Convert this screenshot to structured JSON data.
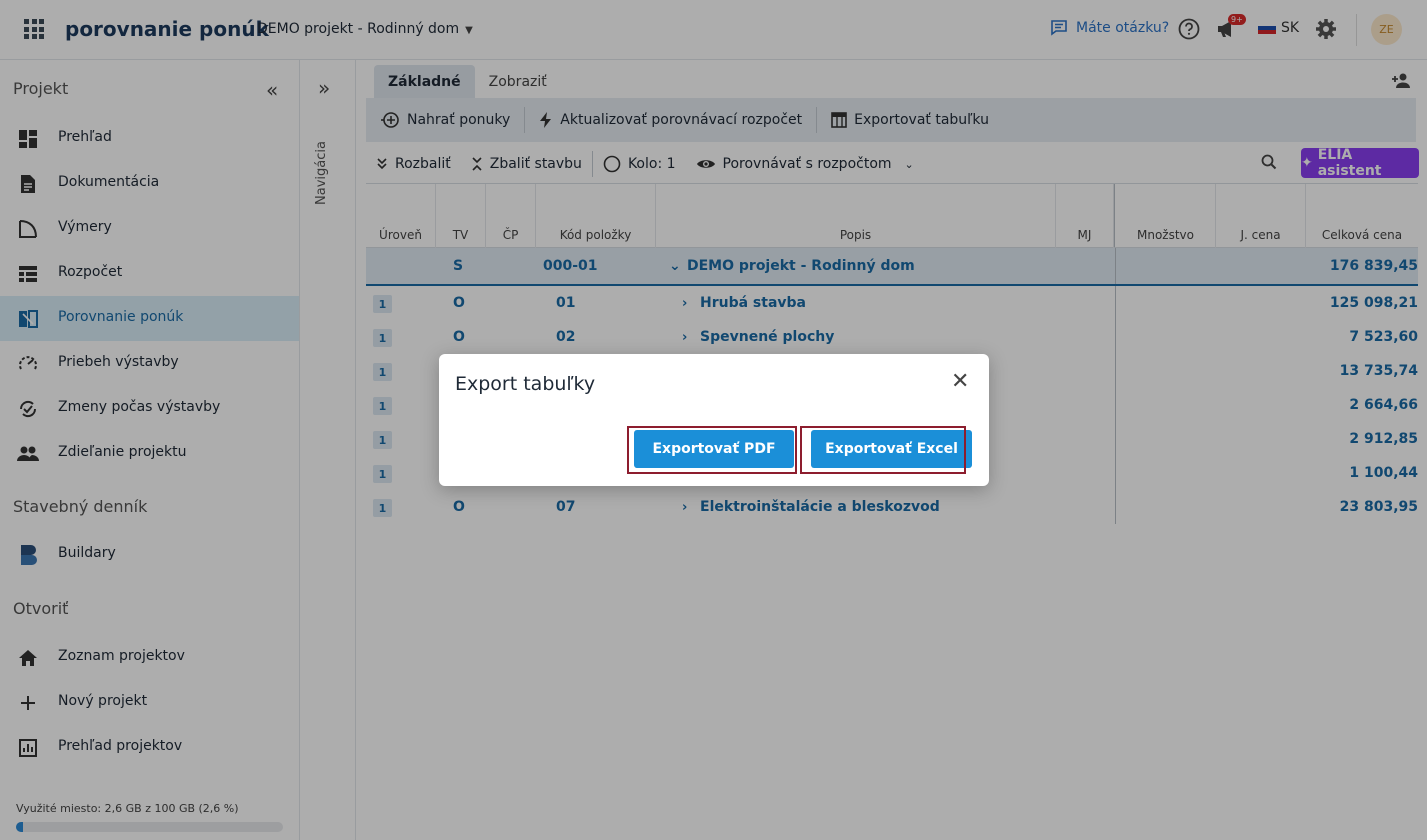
{
  "app": {
    "brand": "porovnanie ponúk",
    "project_selector": "DEMO projekt - Rodinný dom",
    "help_link": "Máte otázku?",
    "notification_badge": "9+",
    "language": "SK",
    "avatar_initials": "ZE"
  },
  "sidebar": {
    "section_project": "Projekt",
    "items": [
      {
        "label": "Prehľad",
        "icon": "dashboard-icon"
      },
      {
        "label": "Dokumentácia",
        "icon": "document-icon"
      },
      {
        "label": "Výmery",
        "icon": "measure-icon"
      },
      {
        "label": "Rozpočet",
        "icon": "budget-icon"
      },
      {
        "label": "Porovnanie ponúk",
        "icon": "compare-icon",
        "active": true
      },
      {
        "label": "Priebeh výstavby",
        "icon": "progress-icon"
      },
      {
        "label": "Zmeny počas výstavby",
        "icon": "changes-icon"
      },
      {
        "label": "Zdieľanie projektu",
        "icon": "people-icon"
      }
    ],
    "section_diary": "Stavebný denník",
    "diary_items": [
      {
        "label": "Buildary",
        "icon": "buildary-icon"
      }
    ],
    "section_open": "Otvoriť",
    "open_items": [
      {
        "label": "Zoznam projektov",
        "icon": "home-icon"
      },
      {
        "label": "Nový projekt",
        "icon": "plus-icon"
      },
      {
        "label": "Prehľad projektov",
        "icon": "chart-icon"
      }
    ],
    "storage_text": "Využité miesto: 2,6 GB z 100 GB (2,6 %)",
    "storage_fraction": 0.026
  },
  "navstrip": {
    "label": "Navigácia"
  },
  "tabs": [
    {
      "label": "Základné",
      "active": true
    },
    {
      "label": "Zobraziť",
      "active": false
    }
  ],
  "toolbar": {
    "upload": "Nahrať ponuky",
    "update": "Aktualizovať porovnávací rozpočet",
    "export": "Exportovať tabuľku",
    "expand": "Rozbaliť",
    "collapse": "Zbaliť stavbu",
    "round": "Kolo: 1",
    "compare": "Porovnávať s rozpočtom",
    "elia": "ELIA asistent"
  },
  "table": {
    "headers": [
      "Úroveň",
      "TV",
      "ČP",
      "Kód položky",
      "Popis",
      "MJ",
      "Množstvo",
      "J. cena",
      "Celková cena"
    ],
    "root": {
      "tv": "S",
      "code": "000-01",
      "desc": "DEMO projekt - Rodinný dom",
      "total": "176 839,45"
    },
    "rows": [
      {
        "level": "1",
        "tv": "O",
        "code": "01",
        "desc": "Hrubá stavba",
        "total": "125 098,21"
      },
      {
        "level": "1",
        "tv": "O",
        "code": "02",
        "desc": "Spevnené plochy",
        "total": "7 523,60"
      },
      {
        "level": "1",
        "tv": "",
        "code": "",
        "desc": "",
        "total": "13 735,74"
      },
      {
        "level": "1",
        "tv": "",
        "code": "",
        "desc": "",
        "total": "2 664,66"
      },
      {
        "level": "1",
        "tv": "",
        "code": "",
        "desc": "",
        "total": "2 912,85"
      },
      {
        "level": "1",
        "tv": "",
        "code": "",
        "desc": "",
        "total": "1 100,44"
      },
      {
        "level": "1",
        "tv": "O",
        "code": "07",
        "desc": "Elektroinštalácie a bleskozvod",
        "total": "23 803,95"
      }
    ]
  },
  "dialog": {
    "title": "Export tabuľky",
    "btn_pdf": "Exportovať PDF",
    "btn_excel": "Exportovať Excel"
  }
}
